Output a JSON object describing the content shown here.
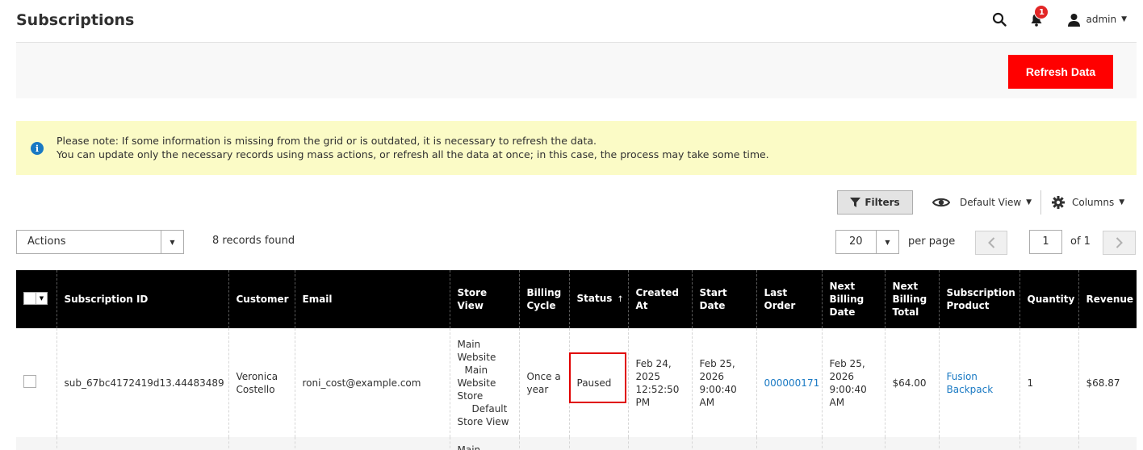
{
  "header": {
    "title": "Subscriptions",
    "notification_count": "1",
    "user_name": "admin"
  },
  "action_bar": {
    "refresh_label": "Refresh Data"
  },
  "notice": {
    "line1": "Please note: If some information is missing from the grid or is outdated, it is necessary to refresh the data.",
    "line2": "You can update only the necessary records using mass actions, or refresh all the data at once; in this case, the process may take some time."
  },
  "controls": {
    "filters_label": "Filters",
    "view_label": "Default View",
    "columns_label": "Columns",
    "actions_label": "Actions",
    "records_found": "8 records found",
    "per_page_value": "20",
    "per_page_label": "per page",
    "current_page": "1",
    "total_pages_label": "of 1"
  },
  "table": {
    "columns": {
      "subscription_id": "Subscription ID",
      "customer": "Customer",
      "email": "Email",
      "store_view": "Store View",
      "billing_cycle_1": "Billing",
      "billing_cycle_2": "Cycle",
      "status": "Status",
      "created_at_1": "Created",
      "created_at_2": "At",
      "start_date_1": "Start",
      "start_date_2": "Date",
      "last_order_1": "Last",
      "last_order_2": "Order",
      "next_billing_date_1": "Next",
      "next_billing_date_2": "Billing",
      "next_billing_date_3": "Date",
      "next_billing_total_1": "Next",
      "next_billing_total_2": "Billing",
      "next_billing_total_3": "Total",
      "subscription_product_1": "Subscription",
      "subscription_product_2": "Product",
      "quantity": "Quantity",
      "revenue": "Revenue"
    },
    "rows": [
      {
        "subscription_id": "sub_67bc4172419d13.44483489",
        "customer_1": "Veronica",
        "customer_2": "Costello",
        "email": "roni_cost@example.com",
        "store_view": [
          "Main",
          "Website",
          "Main",
          "Website",
          "Store",
          "Default",
          "Store View"
        ],
        "billing_cycle_1": "Once a",
        "billing_cycle_2": "year",
        "status": "Paused",
        "created_at": [
          "Feb 24,",
          "2025",
          "12:52:50",
          "PM"
        ],
        "start_date": [
          "Feb 25,",
          "2026",
          "9:00:40",
          "AM"
        ],
        "last_order": "000000171",
        "next_billing_date": [
          "Feb 25,",
          "2026",
          "9:00:40",
          "AM"
        ],
        "next_billing_total": "$64.00",
        "product_1": "Fusion",
        "product_2": "Backpack",
        "quantity": "1",
        "revenue": "$68.87"
      },
      {
        "store_view_partial": "Main"
      }
    ]
  }
}
